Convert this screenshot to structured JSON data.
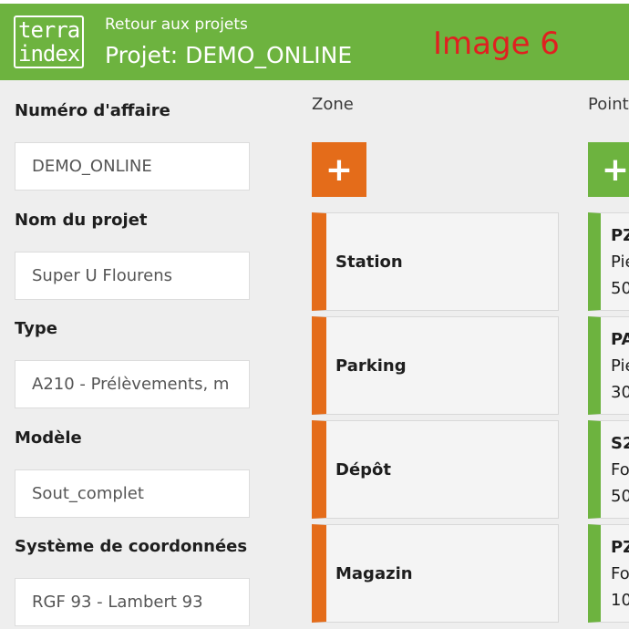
{
  "header": {
    "logo_line1": "terra",
    "logo_line2": "index",
    "back_link": "Retour aux projets",
    "title": "Projet: DEMO_ONLINE",
    "image_label": "Image 6"
  },
  "form": {
    "fields": [
      {
        "label": "Numéro d'affaire",
        "value": "DEMO_ONLINE"
      },
      {
        "label": "Nom du projet",
        "value": "Super U Flourens"
      },
      {
        "label": "Type",
        "value": "A210 - Prélèvements, m"
      },
      {
        "label": "Modèle",
        "value": "Sout_complet"
      },
      {
        "label": "Système de coordonnées",
        "value": "RGF 93 - Lambert 93"
      }
    ]
  },
  "zones": {
    "header": "Zone",
    "add_label": "+",
    "items": [
      "Station",
      "Parking",
      "Dépôt",
      "Magazin"
    ]
  },
  "points": {
    "header": "Point",
    "add_label": "+",
    "items": [
      {
        "l1": "PZ",
        "l2": "Pie",
        "l3": "50"
      },
      {
        "l1": "PA",
        "l2": "Pie",
        "l3": "30"
      },
      {
        "l1": "S2",
        "l2": "Fo",
        "l3": "50"
      },
      {
        "l1": "PZ",
        "l2": "Fo",
        "l3": "10"
      }
    ]
  },
  "colors": {
    "brand_green": "#6db33f",
    "zone_orange": "#e46c1a",
    "annotation_red": "#e02020"
  }
}
